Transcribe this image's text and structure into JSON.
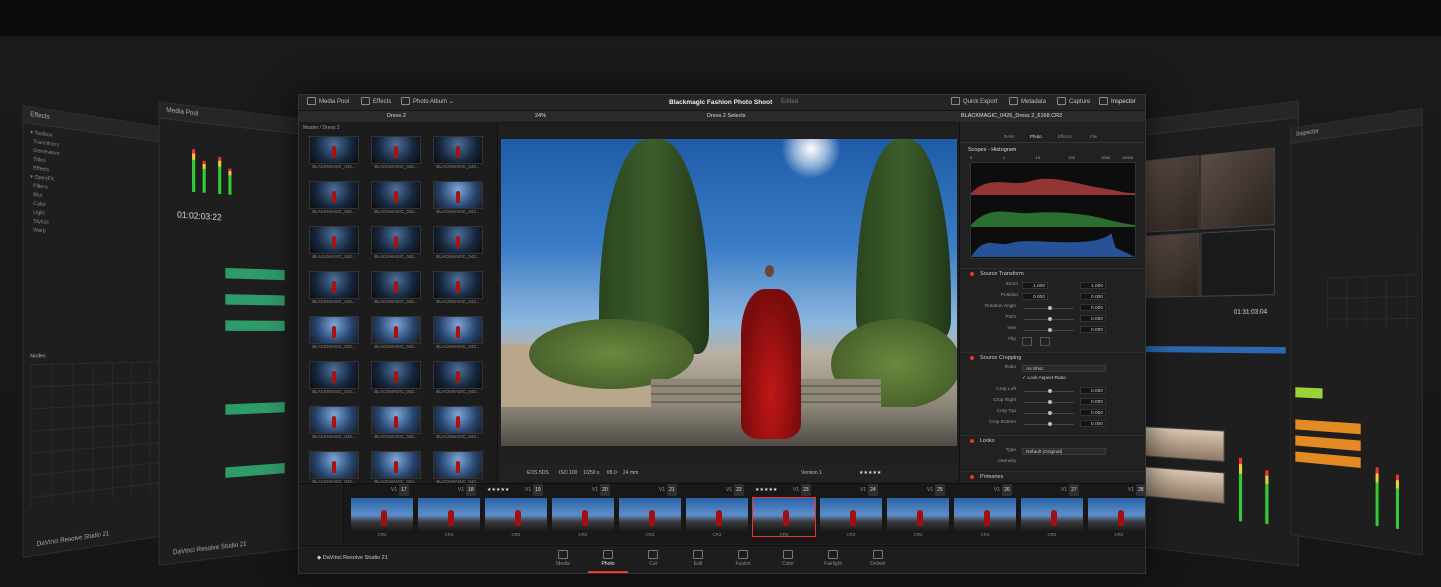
{
  "main_window": {
    "toolbar": {
      "media_pool": "Media Pool",
      "effects": "Effects",
      "photo_album": "Photo Album",
      "title": "Blackmagic Fashion Photo Shoot",
      "status": "Edited",
      "quick_export": "Quick Export",
      "metadata": "Metadata",
      "capture": "Capture",
      "inspector": "Inspector"
    },
    "subbar": {
      "bin_name": "Dress 2",
      "zoom": "24%",
      "selects": "Dress 2 Selects",
      "file_name": "BLACKMAGIC_0426_Dress 2_6168.CR2"
    },
    "browser": {
      "breadcrumb": "Master / Dress 2",
      "thumb_caption": "BLACKMAGIC_042..."
    },
    "viewer_status": {
      "camera": "EOS 5DS",
      "iso": "ISO 100",
      "shutter": "1/250 s",
      "aperture": "f/8.0",
      "focal": "24 mm",
      "version": "Version 1",
      "stars": "★★★★★"
    },
    "inspector": {
      "tabs": [
        "RAW",
        "Photo",
        "Effects",
        "File"
      ],
      "scopes_title": "Scopes - Histogram",
      "histo_scale": [
        "0",
        "1",
        "10",
        "100",
        "1000",
        "10000"
      ],
      "source_transform": "Source Transform",
      "zoom_label": "Zoom",
      "zoom_x": "1.000",
      "zoom_y": "1.000",
      "position_label": "Position",
      "position_x": "0.000",
      "position_y": "0.000",
      "rotation_label": "Rotation Angle",
      "rotation": "0.000",
      "pitch_label": "Pitch",
      "pitch": "0.000",
      "yaw_label": "Yaw",
      "yaw": "0.000",
      "flip_label": "Flip",
      "source_cropping": "Source Cropping",
      "ratio_label": "Ratio",
      "ratio": "As Shot",
      "lock_ratio": "Lock Aspect Ratio",
      "crop_left_label": "Crop Left",
      "crop_left": "0.000",
      "crop_right_label": "Crop Right",
      "crop_right": "0.000",
      "crop_top_label": "Crop Top",
      "crop_top": "0.000",
      "crop_bottom_label": "Crop Bottom",
      "crop_bottom": "0.000",
      "looks": "Looks",
      "type_label": "Type",
      "type": "Default (Original)",
      "intensity_label": "Intensity",
      "primaries": "Primaries"
    },
    "filmstrip": {
      "entries": [
        {
          "v": "V1",
          "n": "17"
        },
        {
          "v": "V1",
          "n": "18"
        },
        {
          "v": "V1",
          "n": "19"
        },
        {
          "v": "V1",
          "n": "20"
        },
        {
          "v": "V1",
          "n": "21"
        },
        {
          "v": "V1",
          "n": "22"
        },
        {
          "v": "V1",
          "n": "23"
        },
        {
          "v": "V1",
          "n": "24"
        },
        {
          "v": "V1",
          "n": "25"
        },
        {
          "v": "V1",
          "n": "26"
        },
        {
          "v": "V1",
          "n": "27"
        },
        {
          "v": "V1",
          "n": "28"
        }
      ],
      "clip_label": "CR2",
      "stars": "★★★★★"
    },
    "pages": [
      "Media",
      "Photo",
      "Cut",
      "Edit",
      "Fusion",
      "Color",
      "Fairlight",
      "Deliver"
    ],
    "active_page": "Photo",
    "brand": "DaVinci Resolve Studio 21"
  },
  "side_panels": {
    "left1_title": "Effects",
    "left1_brand": "DaVinci Resolve Studio 21",
    "left1_nodes": "Nodes",
    "left2_title": "Media Pool",
    "left2_timecode": "01:02:03:22",
    "left2_brand": "DaVinci Resolve Studio 21",
    "right1_timecode": "01:31:03:04",
    "right2_title": "Inspector"
  },
  "colors": {
    "accent": "#e23a3a",
    "bg": "#141414",
    "panel": "#1f1f20"
  }
}
